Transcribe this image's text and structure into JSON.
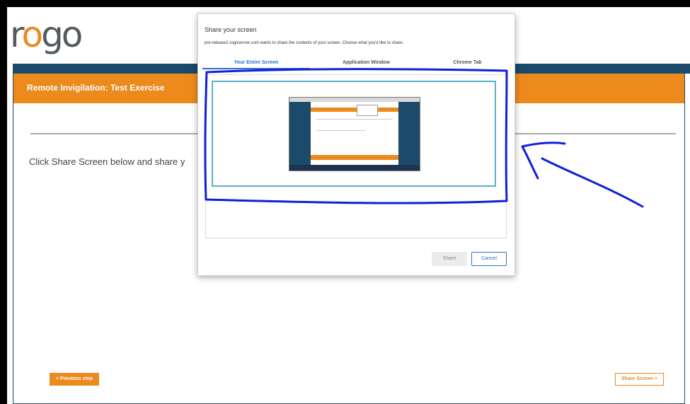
{
  "app": {
    "logo_text_a": "r",
    "logo_text_o": "o",
    "logo_text_b": "go"
  },
  "exam": {
    "title": "Remote Invigilation: Test Exercise",
    "instruction": "Click Share Screen below and share y",
    "prev_button": "< Previous step",
    "share_screen_button": "Share Screen >"
  },
  "dialog": {
    "title": "Share your screen",
    "description": "pre-release2.rogoserver.com wants to share the contents of your screen. Choose what you'd like to share.",
    "tabs": [
      {
        "label": "Your Entire Screen",
        "active": true
      },
      {
        "label": "Application Window",
        "active": false
      },
      {
        "label": "Chrome Tab",
        "active": false
      }
    ],
    "share_button": "Share",
    "cancel_button": "Cancel"
  },
  "colors": {
    "accent": "#ec8a1e",
    "navy": "#1b4a6b",
    "link_blue": "#2b6fcf",
    "annotation": "#1020d8"
  }
}
